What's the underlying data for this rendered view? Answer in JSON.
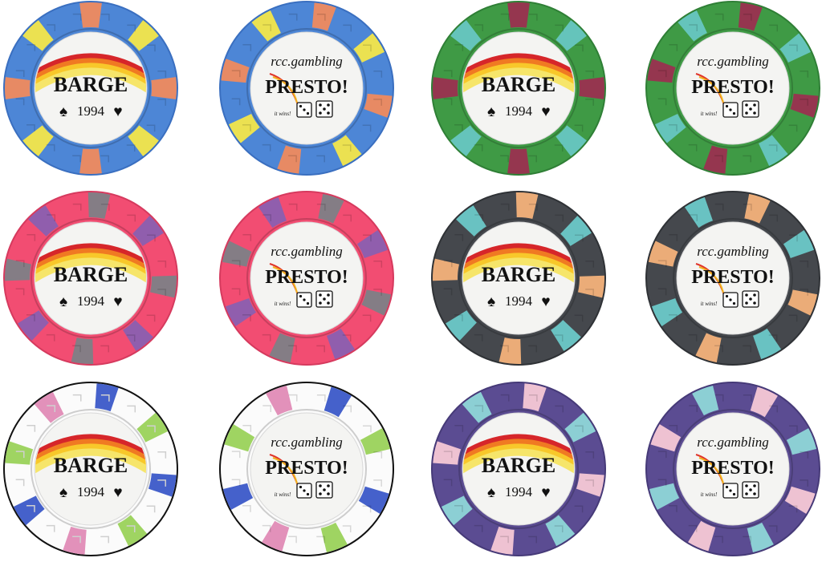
{
  "chips": [
    {
      "design": "barge",
      "base": "#4d86d6",
      "edge": "#3a6fc0",
      "spots": [
        "#ef8a5e",
        "#f3e64a",
        "#ef8a5e",
        "#f3e64a",
        "#ef8a5e",
        "#f3e64a",
        "#ef8a5e",
        "#f3e64a"
      ]
    },
    {
      "design": "presto",
      "base": "#4d86d6",
      "edge": "#3a6fc0",
      "spots": [
        "#ef8a5e",
        "#f3e64a",
        "#ef8a5e",
        "#f3e64a",
        "#ef8a5e",
        "#f3e64a",
        "#ef8a5e",
        "#f3e64a"
      ]
    },
    {
      "design": "barge",
      "base": "#3f9a45",
      "edge": "#2f7f36",
      "spots": [
        "#9a3050",
        "#67c6c2",
        "#9a3050",
        "#67c6c2",
        "#9a3050",
        "#67c6c2",
        "#9a3050",
        "#67c6c2"
      ]
    },
    {
      "design": "presto",
      "base": "#3f9a45",
      "edge": "#2f7f36",
      "spots": [
        "#9a3050",
        "#67c6c2",
        "#9a3050",
        "#67c6c2",
        "#9a3050",
        "#67c6c2",
        "#9a3050",
        "#67c6c2"
      ]
    },
    {
      "design": "barge",
      "base": "#f24d72",
      "edge": "#d63a5e",
      "spots": [
        "#7d7f86",
        "#8a5fb0",
        "#7d7f86",
        "#8a5fb0",
        "#7d7f86",
        "#8a5fb0",
        "#7d7f86",
        "#8a5fb0"
      ]
    },
    {
      "design": "presto",
      "base": "#f24d72",
      "edge": "#d63a5e",
      "spots": [
        "#7d7f86",
        "#8a5fb0",
        "#7d7f86",
        "#8a5fb0",
        "#7d7f86",
        "#8a5fb0",
        "#7d7f86",
        "#8a5fb0"
      ]
    },
    {
      "design": "barge",
      "base": "#45484d",
      "edge": "#2f3236",
      "spots": [
        "#f4b27a",
        "#6cc9c8",
        "#f4b27a",
        "#6cc9c8",
        "#f4b27a",
        "#6cc9c8",
        "#f4b27a",
        "#6cc9c8"
      ]
    },
    {
      "design": "presto",
      "base": "#45484d",
      "edge": "#2f3236",
      "spots": [
        "#f4b27a",
        "#6cc9c8",
        "#f4b27a",
        "#6cc9c8",
        "#f4b27a",
        "#6cc9c8",
        "#f4b27a",
        "#6cc9c8"
      ]
    },
    {
      "design": "barge",
      "base": "#fbfbfb",
      "edge": "#111111",
      "spots": [
        "#3b59c8",
        "#9ad25a",
        "#e08bb6",
        "#3b59c8",
        "#9ad25a",
        "#e08bb6",
        "#3b59c8",
        "#9ad25a"
      ]
    },
    {
      "design": "presto",
      "base": "#fbfbfb",
      "edge": "#111111",
      "spots": [
        "#3b59c8",
        "#9ad25a",
        "#e08bb6",
        "#3b59c8",
        "#9ad25a",
        "#e08bb6",
        "#3b59c8",
        "#9ad25a"
      ]
    },
    {
      "design": "barge",
      "base": "#5b4c92",
      "edge": "#463a78",
      "spots": [
        "#f7c8d6",
        "#8fd6d8",
        "#f7c8d6",
        "#8fd6d8",
        "#f7c8d6",
        "#8fd6d8",
        "#f7c8d6",
        "#8fd6d8"
      ]
    },
    {
      "design": "presto",
      "base": "#5b4c92",
      "edge": "#463a78",
      "spots": [
        "#f7c8d6",
        "#8fd6d8",
        "#f7c8d6",
        "#8fd6d8",
        "#f7c8d6",
        "#8fd6d8",
        "#f7c8d6",
        "#8fd6d8"
      ]
    }
  ],
  "barge": {
    "title": "BARGE",
    "year": "1994",
    "suit_left": "♠",
    "suit_right": "♥",
    "rainbow": [
      "#d6262a",
      "#f07a22",
      "#f8c82a",
      "#f6e56a"
    ]
  },
  "presto": {
    "top": "rcc.gambling",
    "title": "PRESTO!",
    "tagline": "it wins!"
  }
}
